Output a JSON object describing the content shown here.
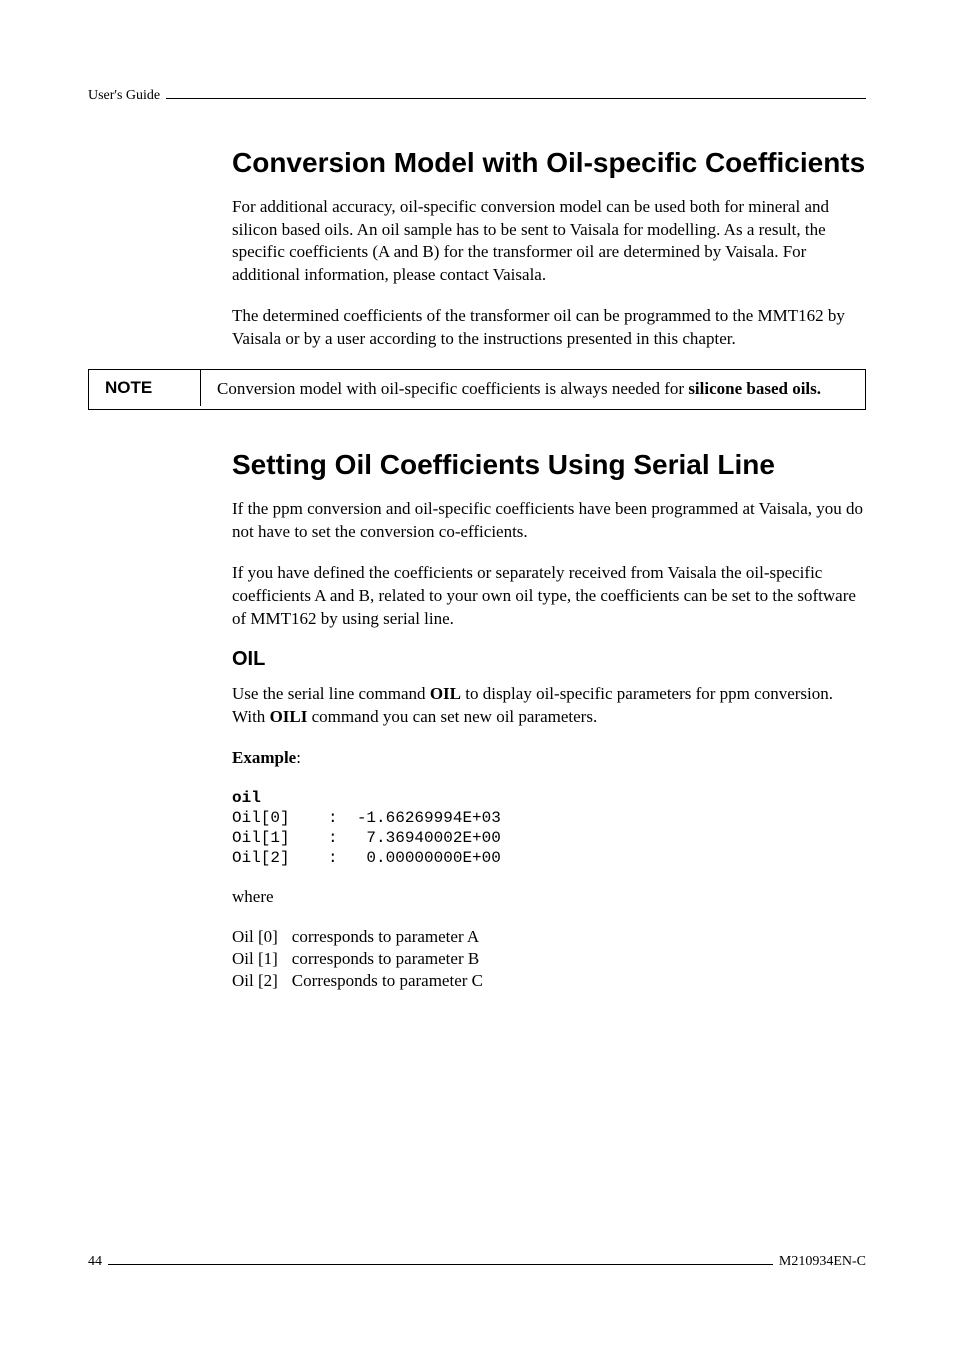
{
  "header": {
    "guide": "User's Guide"
  },
  "section1": {
    "title": "Conversion Model with Oil-specific Coefficients",
    "p1": "For additional accuracy, oil-specific conversion model can be used both for mineral and silicon based oils. An oil sample has to be sent to Vaisala for modelling. As a result, the specific coefficients (A and B) for the transformer oil are determined by Vaisala. For additional information, please contact Vaisala.",
    "p2": "The determined coefficients of the transformer oil can be programmed to the MMT162 by Vaisala or by a user according to the instructions presented in this chapter."
  },
  "note": {
    "label": "NOTE",
    "text_prefix": "Conversion model with oil-specific coefficients is always needed for ",
    "text_bold": "silicone based oils."
  },
  "section2": {
    "title": "Setting Oil Coefficients Using Serial Line",
    "p1": "If the ppm conversion and oil-specific coefficients have been programmed at Vaisala, you do not have to set the conversion co-efficients.",
    "p2": "If you have defined the coefficients or separately received from Vaisala the oil-specific coefficients A and B, related to your own oil type, the coefficients can be set to the software of MMT162 by using serial line."
  },
  "oil": {
    "heading": "OIL",
    "desc_pre": "Use the serial line command ",
    "cmd1": "OIL",
    "desc_mid": " to display oil-specific parameters for ppm conversion. With ",
    "cmd2": "OILI",
    "desc_post": " command you can set new oil parameters.",
    "example_label": "Example",
    "example_colon": ":",
    "code_cmd": "oil",
    "code_lines": "Oil[0]    :  -1.66269994E+03\nOil[1]    :   7.36940002E+00\nOil[2]    :   0.00000000E+00",
    "where": "where",
    "defs": [
      {
        "k": "Oil [0]",
        "v": "corresponds to parameter A"
      },
      {
        "k": "Oil [1]",
        "v": "corresponds to parameter B"
      },
      {
        "k": "Oil [2]",
        "v": "Corresponds to parameter C"
      }
    ]
  },
  "footer": {
    "page": "44",
    "doc": "M210934EN-C"
  }
}
